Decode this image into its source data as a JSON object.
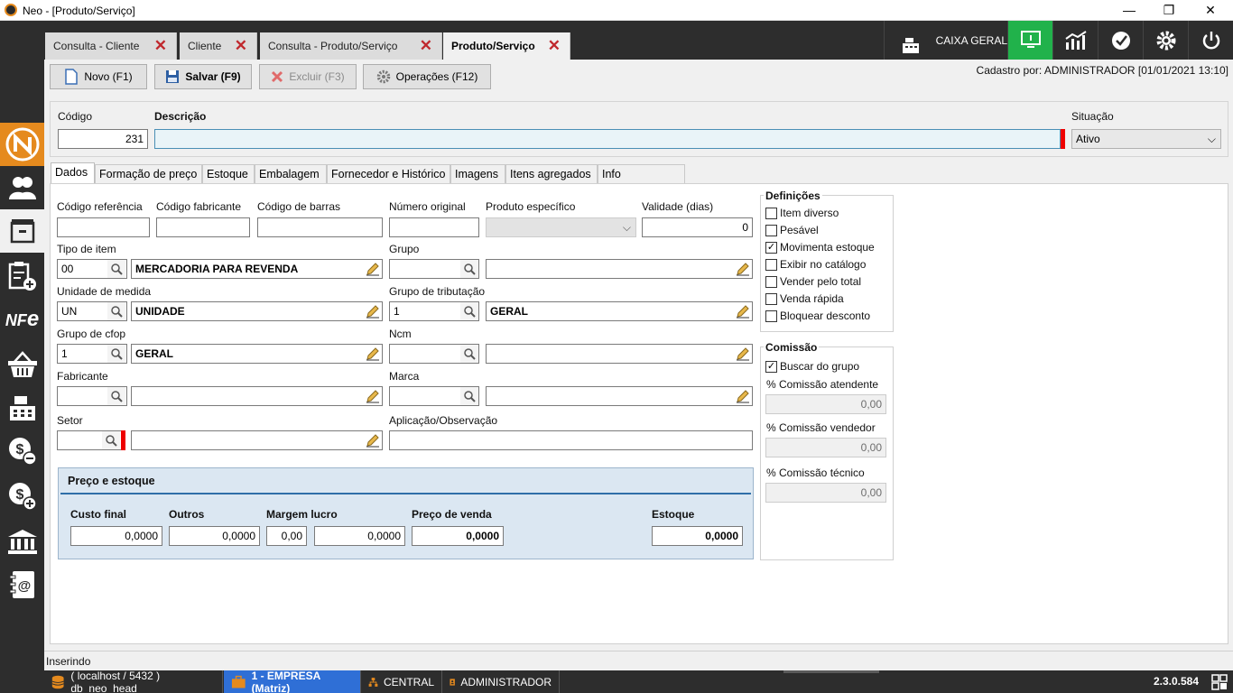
{
  "window": {
    "title": "Neo - [Produto/Serviço]",
    "minimize": "—",
    "restore": "❐",
    "close": "✕"
  },
  "tabs": [
    {
      "label": "Consulta - Cliente"
    },
    {
      "label": "Cliente"
    },
    {
      "label": "Consulta - Produto/Serviço"
    },
    {
      "label": "Produto/Serviço",
      "active": true
    }
  ],
  "top_right": {
    "caixa_label": "CAIXA GERAL"
  },
  "toolbar": {
    "novo": "Novo (F1)",
    "salvar": "Salvar (F9)",
    "excluir": "Excluir (F3)",
    "operacoes": "Operações (F12)",
    "cadastro_info": "Cadastro por: ADMINISTRADOR [01/01/2021 13:10]"
  },
  "header": {
    "codigo_label": "Código",
    "codigo_value": "231",
    "descricao_label": "Descrição",
    "descricao_value": "",
    "situacao_label": "Situação",
    "situacao_value": "Ativo"
  },
  "subtabs": [
    "Dados",
    "Formação de preço",
    "Estoque",
    "Embalagem",
    "Fornecedor e Histórico",
    "Imagens",
    "Itens agregados",
    "Info nutricionais"
  ],
  "fields": {
    "cod_ref_label": "Código referência",
    "cod_ref_value": "",
    "cod_fab_label": "Código fabricante",
    "cod_fab_value": "",
    "cod_barras_label": "Código de barras",
    "cod_barras_value": "",
    "num_orig_label": "Número original",
    "num_orig_value": "",
    "prod_esp_label": "Produto específico",
    "prod_esp_value": "",
    "validade_label": "Validade (dias)",
    "validade_value": "0",
    "tipo_item_label": "Tipo de item",
    "tipo_item_code": "00",
    "tipo_item_desc": "MERCADORIA PARA REVENDA",
    "grupo_label": "Grupo",
    "grupo_code": "",
    "grupo_desc": "",
    "unidade_label": "Unidade de medida",
    "unidade_code": "UN",
    "unidade_desc": "UNIDADE",
    "grupo_trib_label": "Grupo de tributação",
    "grupo_trib_code": "1",
    "grupo_trib_desc": "GERAL",
    "grupo_cfop_label": "Grupo de cfop",
    "grupo_cfop_code": "1",
    "grupo_cfop_desc": "GERAL",
    "ncm_label": "Ncm",
    "ncm_code": "",
    "ncm_desc": "",
    "fabricante_label": "Fabricante",
    "fabricante_code": "",
    "fabricante_desc": "",
    "marca_label": "Marca",
    "marca_code": "",
    "marca_desc": "",
    "setor_label": "Setor",
    "setor_code": "",
    "setor_desc": "",
    "aplicacao_label": "Aplicação/Observação",
    "aplicacao_value": ""
  },
  "preco": {
    "title": "Preço e estoque",
    "custo_label": "Custo final",
    "custo_value": "0,0000",
    "outros_label": "Outros",
    "outros_value": "0,0000",
    "margem_label": "Margem lucro",
    "margem_pct": "0,00",
    "margem_value": "0,0000",
    "preco_label": "Preço de venda",
    "preco_value": "0,0000",
    "estoque_label": "Estoque",
    "estoque_value": "0,0000"
  },
  "definicoes": {
    "title": "Definições",
    "items": [
      {
        "label": "Item diverso",
        "checked": false
      },
      {
        "label": "Pesável",
        "checked": false
      },
      {
        "label": "Movimenta estoque",
        "checked": true
      },
      {
        "label": "Exibir no catálogo",
        "checked": false
      },
      {
        "label": "Vender pelo total",
        "checked": false
      },
      {
        "label": "Venda rápida",
        "checked": false
      },
      {
        "label": "Bloquear desconto",
        "checked": false
      }
    ]
  },
  "comissao": {
    "title": "Comissão",
    "buscar_label": "Buscar do grupo",
    "buscar_checked": true,
    "atendente_label": "% Comissão atendente",
    "atendente_value": "0,00",
    "vendedor_label": "% Comissão vendedor",
    "vendedor_value": "0,00",
    "tecnico_label": "% Comissão técnico",
    "tecnico_value": "0,00"
  },
  "status": {
    "mode": "Inserindo"
  },
  "statusbar": {
    "db": "( localhost / 5432 ) db_neo_head",
    "empresa": "1 - EMPRESA (Matriz)",
    "central": "CENTRAL",
    "user": "ADMINISTRADOR",
    "version": "2.3.0.584"
  },
  "colors": {
    "accent_green": "#21b24b",
    "dark": "#2d2d2d",
    "status_blue": "#2f6fd6",
    "close_red": "#c0282d"
  }
}
